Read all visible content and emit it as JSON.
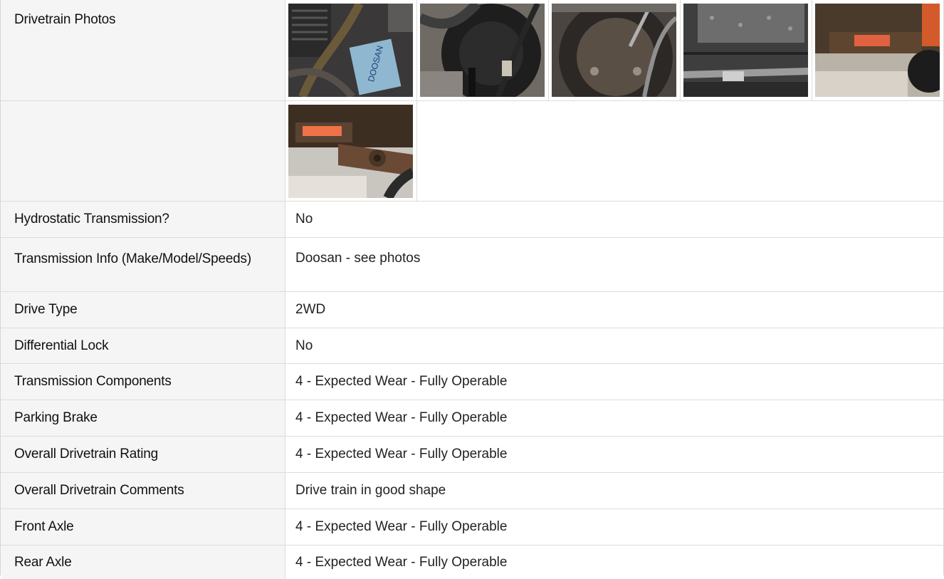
{
  "drivetrain_photos": {
    "label": "Drivetrain Photos",
    "photo_icons": [
      "engine-photo",
      "hose-photo",
      "wheel-photo",
      "undercarriage-photo",
      "axle-photo",
      "pin-joint-photo"
    ]
  },
  "rows": [
    {
      "label": "Hydrostatic Transmission?",
      "value": "No"
    },
    {
      "label": "Transmission Info (Make/Model/Speeds)",
      "value": "Doosan - see photos"
    },
    {
      "label": "Drive Type",
      "value": "2WD"
    },
    {
      "label": "Differential Lock",
      "value": "No"
    },
    {
      "label": "Transmission Components",
      "value": "4 - Expected Wear - Fully Operable"
    },
    {
      "label": "Parking Brake",
      "value": "4 - Expected Wear - Fully Operable"
    },
    {
      "label": "Overall Drivetrain Rating",
      "value": "4 - Expected Wear - Fully Operable"
    },
    {
      "label": "Overall Drivetrain Comments",
      "value": "Drive train in good shape"
    },
    {
      "label": "Front Axle",
      "value": "4 - Expected Wear - Fully Operable"
    },
    {
      "label": "Rear Axle",
      "value": "4 - Expected Wear - Fully Operable"
    }
  ],
  "colors": {
    "label_bg": "#f5f5f5",
    "border": "#dcdcdc",
    "text": "#111111"
  }
}
